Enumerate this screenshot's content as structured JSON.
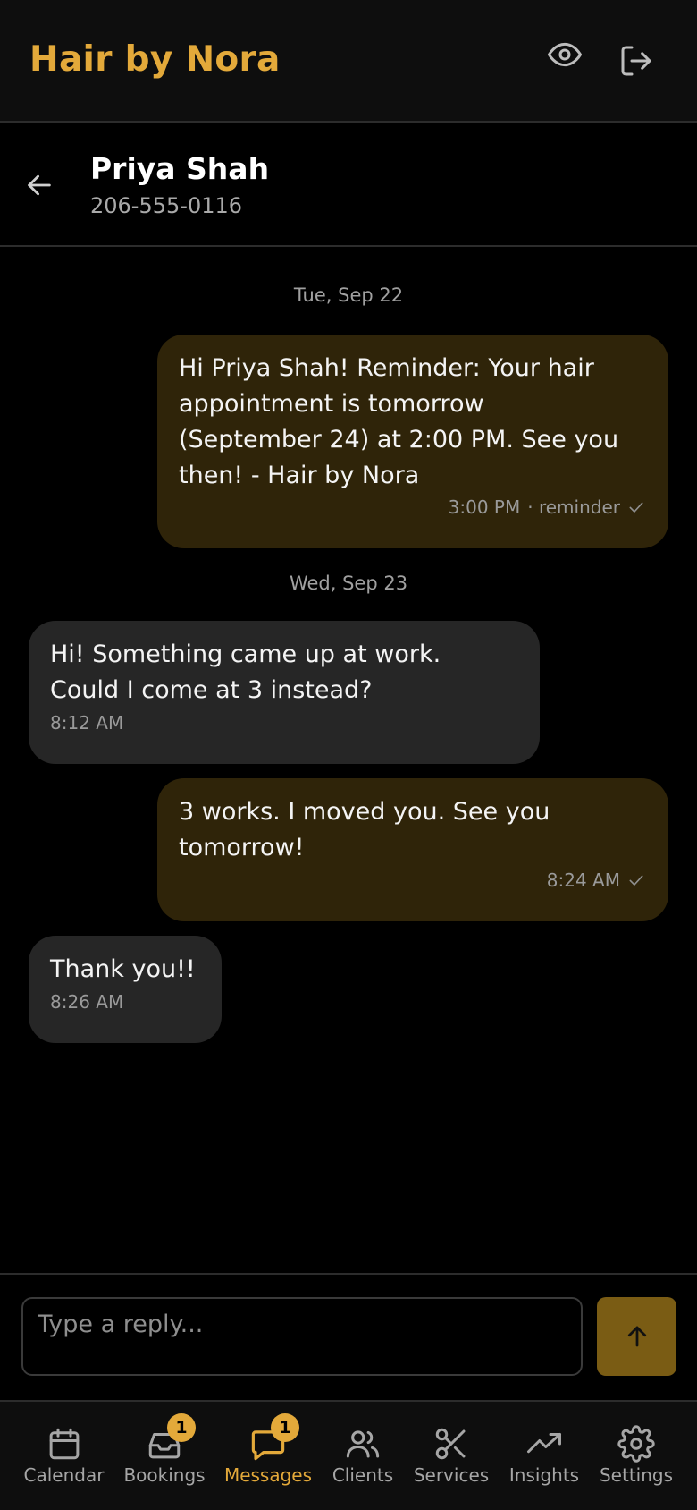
{
  "app": {
    "title": "Hair by Nora",
    "accent_color": "#e3a93a"
  },
  "topbar": {
    "icons": [
      "eye-icon",
      "logout-icon"
    ]
  },
  "conversation": {
    "contact_name": "Priya Shah",
    "contact_phone": "206-555-0116",
    "date_separators": [
      "Tue, Sep 22",
      "Wed, Sep 23"
    ],
    "messages": [
      {
        "direction": "outgoing",
        "text": "Hi Priya Shah! Reminder: Your hair\nappointment is tomorrow\n(September 24) at 2:00 PM. See you\nthen! - Hair by Nora",
        "time": "3:00 PM",
        "tag": "· reminder",
        "status": "check-icon"
      },
      {
        "direction": "incoming",
        "text": "Hi! Something came up at work.\nCould I come at 3 instead?",
        "time": "8:12 AM"
      },
      {
        "direction": "outgoing",
        "text": "3 works. I moved you. See you\ntomorrow!",
        "time": "8:24 AM",
        "status": "check-icon"
      },
      {
        "direction": "incoming",
        "text": "Thank you!!",
        "time": "8:26 AM"
      }
    ]
  },
  "reply": {
    "placeholder": "Type a reply...",
    "value": ""
  },
  "nav": {
    "items": [
      {
        "label": "Calendar",
        "icon": "calendar-icon"
      },
      {
        "label": "Bookings",
        "icon": "inbox-icon",
        "badge": "1"
      },
      {
        "label": "Messages",
        "icon": "message-icon",
        "badge": "1",
        "active": true
      },
      {
        "label": "Clients",
        "icon": "users-icon"
      },
      {
        "label": "Services",
        "icon": "scissors-icon"
      },
      {
        "label": "Insights",
        "icon": "trending-up-icon"
      },
      {
        "label": "Settings",
        "icon": "gear-icon"
      }
    ]
  }
}
